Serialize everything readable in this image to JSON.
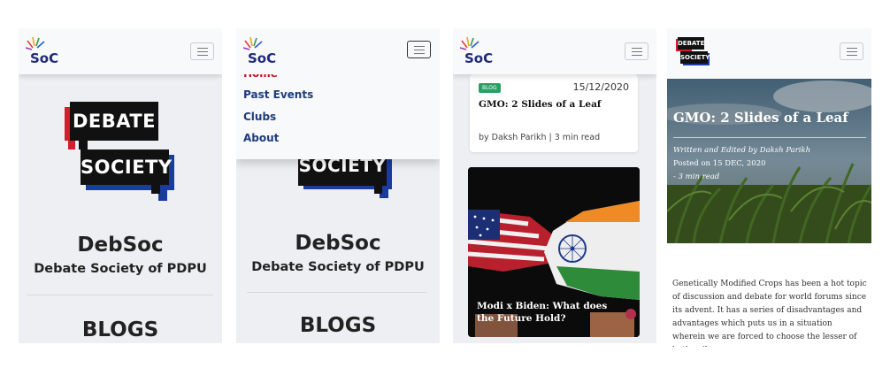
{
  "brand": {
    "logo_text": "SoC"
  },
  "home": {
    "logo_line1": "DEBATE",
    "logo_line2": "SOCIETY",
    "title": "DebSoc",
    "subtitle": "Debate Society of PDPU",
    "section": "BLOGS"
  },
  "menu": {
    "items": [
      {
        "label": "Home"
      },
      {
        "label": "Past Events"
      },
      {
        "label": "Clubs"
      },
      {
        "label": "About"
      }
    ],
    "partial_logo": "SOCIETY"
  },
  "blog": {
    "card1": {
      "badge": "BLOG",
      "date": "15/12/2020",
      "title": "GMO: 2 Slides of a Leaf",
      "byline": "by Daksh Parikh | 3 min read"
    },
    "card2": {
      "title": "Modi x Biden: What does the Future Hold?"
    }
  },
  "article": {
    "logo_line1": "DEBATE",
    "logo_line2": "SOCIETY",
    "title": "GMO: 2 Slides of a Leaf",
    "meta1": "Written and Edited by Daksh Parikh",
    "meta2": "Posted on 15 DEC, 2020",
    "meta3": "- 3 min read",
    "body": "Genetically Modified Crops has been a hot topic of discussion and debate for world forums since its advent. It has a series of disadvantages and advantages which puts us in a situation wherein we are forced to choose the lesser of both evils."
  },
  "colors": {
    "nav_bg": "#f8f9fa",
    "menu_text": "#1f3b7e",
    "menu_active": "#c0141e",
    "badge": "#28a064",
    "logo_red": "#d21f2b",
    "logo_blue": "#1a3c9c"
  }
}
